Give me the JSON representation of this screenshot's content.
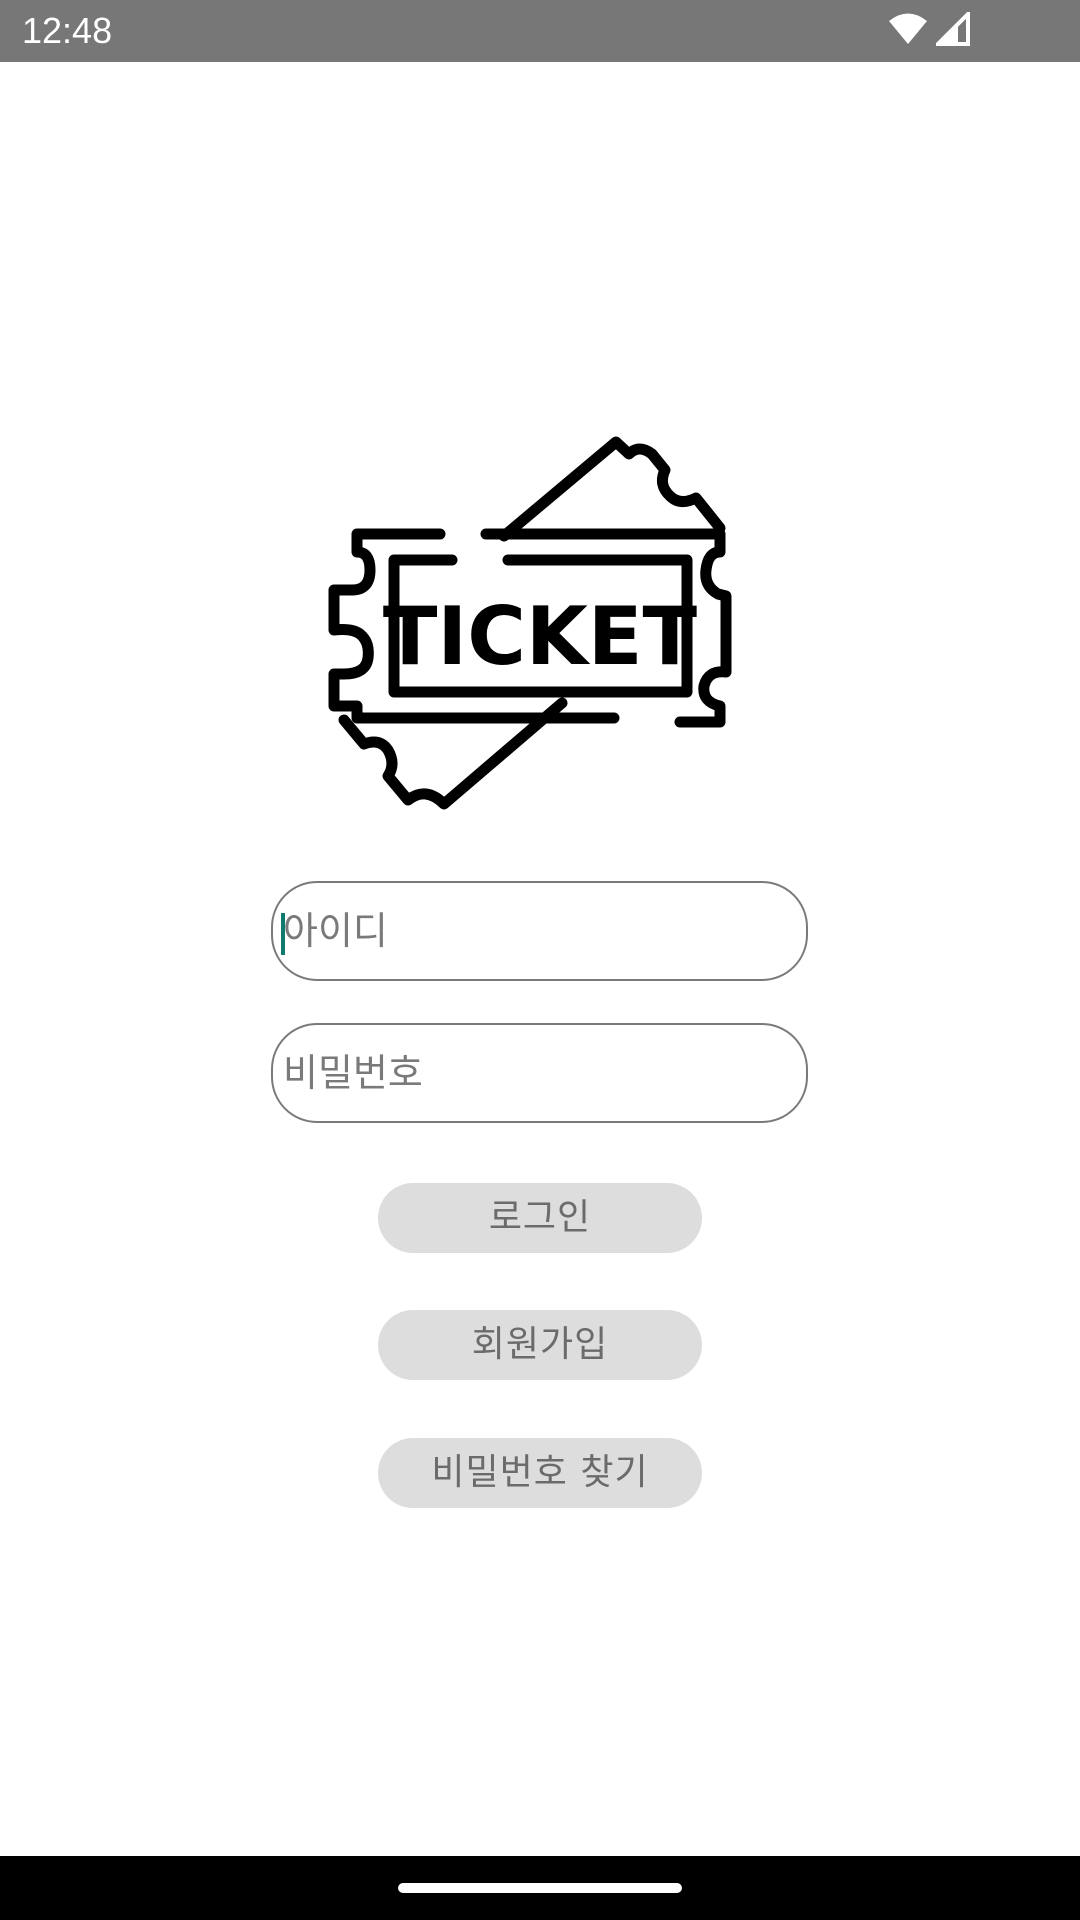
{
  "status_bar": {
    "time": "12:48",
    "icons": [
      "wifi-icon",
      "cell-signal-icon"
    ],
    "color": "#777777"
  },
  "logo": {
    "text": "TICKET",
    "icon": "ticket-icon"
  },
  "login_form": {
    "id_placeholder": "아이디",
    "password_placeholder": "비밀번호",
    "focused_field": "id"
  },
  "buttons": {
    "login_label": "로그인",
    "signup_label": "회원가입",
    "find_password_label": "비밀번호 찾기"
  },
  "colors": {
    "caret": "#0f7a6e",
    "button_bg": "#dddddd",
    "field_border": "#7a7a7a"
  }
}
